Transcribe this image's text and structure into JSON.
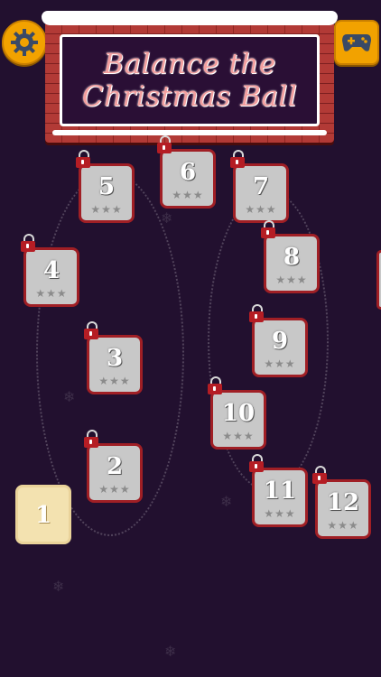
{
  "title": {
    "line1": "Balance the",
    "line2": "Christmas Ball"
  },
  "buttons": {
    "settings_icon": "gear-icon",
    "games_icon": "gamepad-icon"
  },
  "colors": {
    "background": "#22102f",
    "tile_locked": "#c8c8c8",
    "tile_border": "#a01f25",
    "tile_unlocked": "#f3e2b0",
    "accent_orange": "#f2a200"
  },
  "levels": [
    {
      "label": "1",
      "locked": false,
      "stars": ""
    },
    {
      "label": "2",
      "locked": true,
      "stars": "★★★"
    },
    {
      "label": "3",
      "locked": true,
      "stars": "★★★"
    },
    {
      "label": "4",
      "locked": true,
      "stars": "★★★"
    },
    {
      "label": "5",
      "locked": true,
      "stars": "★★★"
    },
    {
      "label": "6",
      "locked": true,
      "stars": "★★★"
    },
    {
      "label": "7",
      "locked": true,
      "stars": "★★★"
    },
    {
      "label": "8",
      "locked": true,
      "stars": "★★★"
    },
    {
      "label": "9",
      "locked": true,
      "stars": "★★★"
    },
    {
      "label": "10",
      "locked": true,
      "stars": "★★★"
    },
    {
      "label": "11",
      "locked": true,
      "stars": "★★★"
    },
    {
      "label": "12",
      "locked": true,
      "stars": "★★★"
    }
  ]
}
